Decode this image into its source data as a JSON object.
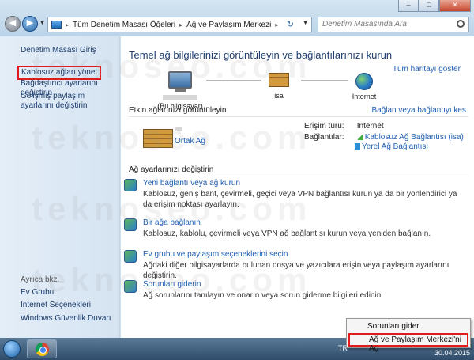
{
  "window": {
    "controls": {
      "minimize": "–",
      "maximize": "□",
      "close": "✕"
    }
  },
  "address_bar": {
    "segments": [
      "Tüm Denetim Masası Öğeleri",
      "Ağ ve Paylaşım Merkezi"
    ],
    "separator": "▸"
  },
  "search": {
    "placeholder": "Denetim Masasında Ara"
  },
  "sidebar": {
    "items": [
      {
        "label": "Denetim Masası Giriş"
      },
      {
        "label": "Kablosuz ağları yönet"
      },
      {
        "label": "Bağdaştırıcı ayarlarını değiştirin"
      },
      {
        "label": "Gelişmiş paylaşım ayarlarını değiştirin"
      }
    ],
    "see_also_heading": "Ayrıca bkz.",
    "see_also": [
      {
        "label": "Ev Grubu"
      },
      {
        "label": "Internet Seçenekleri"
      },
      {
        "label": "Windows Güvenlik Duvarı"
      }
    ]
  },
  "main": {
    "title": "Temel ağ bilgilerinizi görüntüleyin ve bağlantılarınızı kurun",
    "full_map_link": "Tüm haritayı göster",
    "map_nodes": {
      "computer": "(Bu bilgisayar)",
      "network": "isa",
      "internet": "Internet"
    },
    "active_networks_label": "Etkin ağlarınızı görüntüleyin",
    "connect_disconnect_link": "Bağlan veya bağlantıyı kes",
    "network_type": "Ortak Ağ",
    "access_type_label": "Erişim türü:",
    "access_type_value": "Internet",
    "connections_label": "Bağlantılar:",
    "connections": [
      "Kablosuz Ağ Bağlantısı (isa)",
      "Yerel Ağ Bağlantısı"
    ],
    "change_settings_label": "Ağ ayarlarınızı değiştirin",
    "tasks": [
      {
        "title": "Yeni bağlantı veya ağ kurun",
        "desc": "Kablosuz, geniş bant, çevirmeli, geçici veya VPN bağlantısı kurun ya da bir yönlendirici ya da erişim noktası ayarlayın."
      },
      {
        "title": "Bir ağa bağlanın",
        "desc": "Kablosuz, kablolu, çevirmeli veya VPN ağ bağlantısı kurun veya yeniden bağlanın."
      },
      {
        "title": "Ev grubu ve paylaşım seçeneklerini seçin",
        "desc": "Ağdaki diğer bilgisayarlarda bulunan dosya ve yazıcılara erişin veya paylaşım ayarlarını değiştirin."
      },
      {
        "title": "Sorunları giderin",
        "desc": "Ağ sorunlarını tanılayın ve onarın veya sorun giderme bilgileri edinin."
      }
    ]
  },
  "context_menu": {
    "items": [
      "Sorunları gider",
      "Ağ ve Paylaşım Merkezi'ni Aç"
    ]
  },
  "taskbar": {
    "tray_text": "TR",
    "date": "30.04.2015"
  },
  "watermark": "teknoseo.com"
}
